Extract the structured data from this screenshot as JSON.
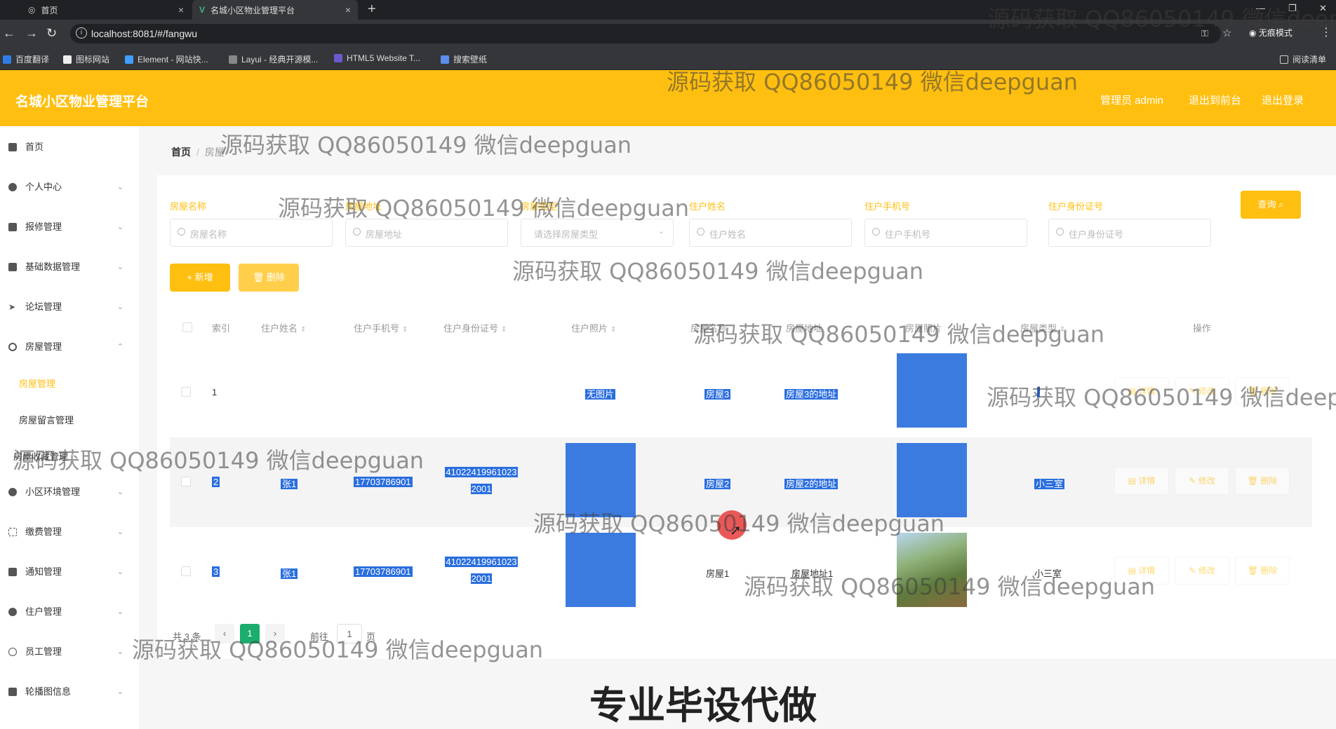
{
  "browser": {
    "tabs": [
      {
        "label": "首页"
      },
      {
        "label": "名城小区物业管理平台"
      }
    ],
    "url": "localhost:8081/#/fangwu",
    "incognito_label": "无痕模式",
    "reading_list": "阅读清单",
    "bookmarks": [
      "百度翻译",
      "图标网站",
      "Element - 网站快...",
      "Layui - 经典开源模...",
      "HTML5 Website T...",
      "搜索壁纸"
    ]
  },
  "header": {
    "title": "名城小区物业管理平台",
    "admin_label": "管理员 admin",
    "back_label": "退出到前台",
    "logout_label": "退出登录"
  },
  "sidebar": {
    "items": [
      {
        "label": "首页"
      },
      {
        "label": "个人中心"
      },
      {
        "label": "报修管理"
      },
      {
        "label": "基础数据管理"
      },
      {
        "label": "论坛管理"
      },
      {
        "label": "房屋管理"
      },
      {
        "label": "小区环境管理"
      },
      {
        "label": "缴费管理"
      },
      {
        "label": "通知管理"
      },
      {
        "label": "住户管理"
      },
      {
        "label": "员工管理"
      },
      {
        "label": "轮播图信息"
      }
    ],
    "sub_items": [
      {
        "label": "房屋管理"
      },
      {
        "label": "房屋留言管理"
      },
      {
        "label": "房屋收藏管理"
      }
    ]
  },
  "breadcrumb": {
    "home": "首页",
    "sep": "/",
    "current": "房屋"
  },
  "filters": {
    "labels": [
      "房屋名称",
      "房屋地址",
      "房屋类型",
      "住户姓名",
      "住户手机号",
      "住户身份证号"
    ],
    "placeholders": [
      "房屋名称",
      "房屋地址",
      "请选择房屋类型",
      "住户姓名",
      "住户手机号",
      "住户身份证号"
    ],
    "query_label": "查询"
  },
  "actions": {
    "add_label": "+ 新增",
    "delete_label": "删除"
  },
  "table": {
    "headers": [
      "索引",
      "住户姓名",
      "住户手机号",
      "住户身份证号",
      "住户照片",
      "房屋名称",
      "房屋地址",
      "房屋照片",
      "房屋类型",
      "操作"
    ],
    "rows": [
      {
        "index": "1",
        "name": "",
        "phone": "",
        "id_line1": "",
        "id_line2": "",
        "photo": "无图片",
        "house": "房屋3",
        "address": "房屋3的地址",
        "type": ""
      },
      {
        "index": "2",
        "name": "张1",
        "phone": "17703786901",
        "id_line1": "41022419961023",
        "id_line2": "2001",
        "photo": "",
        "house": "房屋2",
        "address": "房屋2的地址",
        "type": "小三室"
      },
      {
        "index": "3",
        "name": "张1",
        "phone": "17703786901",
        "id_line1": "41022419961023",
        "id_line2": "2001",
        "photo": "",
        "house": "房屋1",
        "address": "房屋地址1",
        "type": "小三室"
      }
    ],
    "op_labels": {
      "detail": "详情",
      "edit": "修改",
      "delete": "删除"
    }
  },
  "pagination": {
    "total": "共 3 条",
    "current_page": "1",
    "goto_label": "前往",
    "goto_value": "1",
    "page_suffix": "页"
  },
  "watermark": "源码获取 QQ86050149 微信deepguan",
  "caption": "专业毕设代做",
  "colors": {
    "brand": "#ffbf10",
    "selection": "#2a6ede",
    "pager_active": "#1aad6b"
  }
}
